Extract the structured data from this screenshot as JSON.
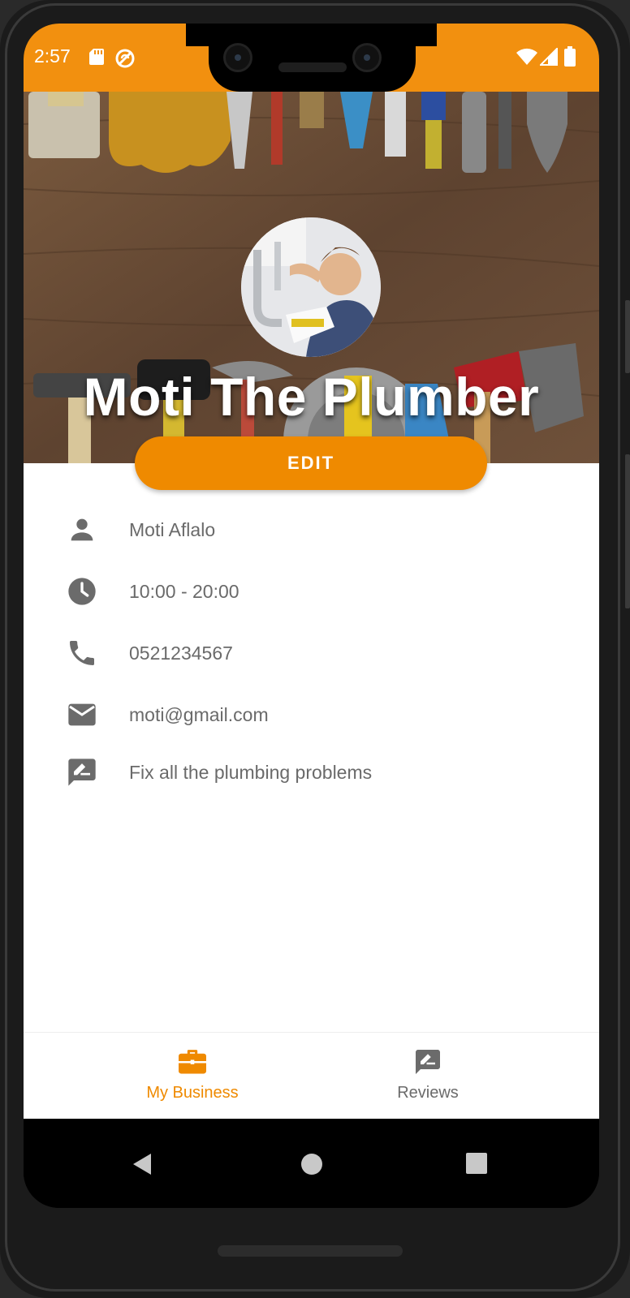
{
  "status_bar": {
    "time": "2:57"
  },
  "header": {
    "business_name": "Moti The Plumber"
  },
  "edit_button": {
    "label": "EDIT"
  },
  "details": [
    {
      "icon": "person-icon",
      "text": "Moti Aflalo"
    },
    {
      "icon": "clock-icon",
      "text": "10:00 - 20:00"
    },
    {
      "icon": "phone-icon",
      "text": "0521234567"
    },
    {
      "icon": "email-icon",
      "text": "moti@gmail.com"
    },
    {
      "icon": "description-icon",
      "text": "Fix all the plumbing problems"
    }
  ],
  "bottom_nav": {
    "items": [
      {
        "label": "My Business",
        "icon": "briefcase-icon",
        "active": true
      },
      {
        "label": "Reviews",
        "icon": "rate-review-icon",
        "active": false
      }
    ]
  },
  "colors": {
    "accent": "#f2900f",
    "button": "#ef8a00",
    "text_secondary": "#6a6a6a",
    "icon_gray": "#6b6b6b"
  }
}
